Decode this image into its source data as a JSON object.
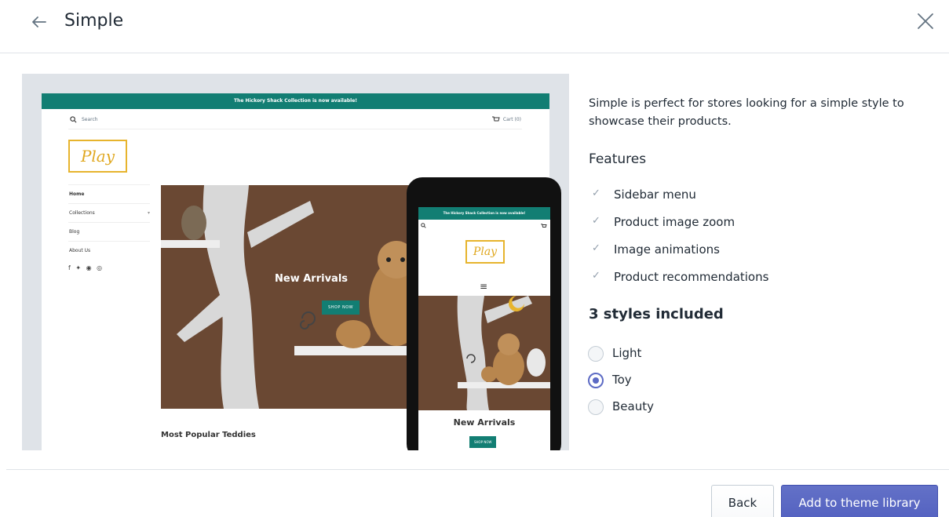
{
  "header": {
    "title": "Simple",
    "back_icon": "arrow-left-icon",
    "close_icon": "close-icon"
  },
  "preview": {
    "desktop": {
      "announcement": "The Hickory Shack Collection is now available!",
      "search_label": "Search",
      "cart_label": "Cart (0)",
      "logo": "Play",
      "nav": [
        "Home",
        "Collections",
        "Blog",
        "About Us"
      ],
      "social": "f ✦ ◉ ◎",
      "hero_title": "New Arrivals",
      "hero_button": "SHOP NOW",
      "section_title": "Most Popular Teddies"
    },
    "mobile": {
      "announcement": "The Hickory Shack Collection is now available!",
      "logo": "Play",
      "menu_icon": "≡",
      "hero_title": "New Arrivals",
      "hero_button": "SHOP NOW"
    }
  },
  "details": {
    "description": "Simple is perfect for stores looking for a simple style to showcase their products.",
    "features_heading": "Features",
    "features": [
      "Sidebar menu",
      "Product image zoom",
      "Image animations",
      "Product recommendations"
    ],
    "styles_heading": "3 styles included",
    "styles": [
      "Light",
      "Toy",
      "Beauty"
    ],
    "selected_style": "Toy"
  },
  "footer": {
    "back_label": "Back",
    "add_label": "Add to theme library"
  },
  "colors": {
    "accent": "#5c6ac4",
    "theme_teal": "#127e73",
    "logo_gold": "#e7b42d",
    "hero_brown": "#6a4833"
  }
}
